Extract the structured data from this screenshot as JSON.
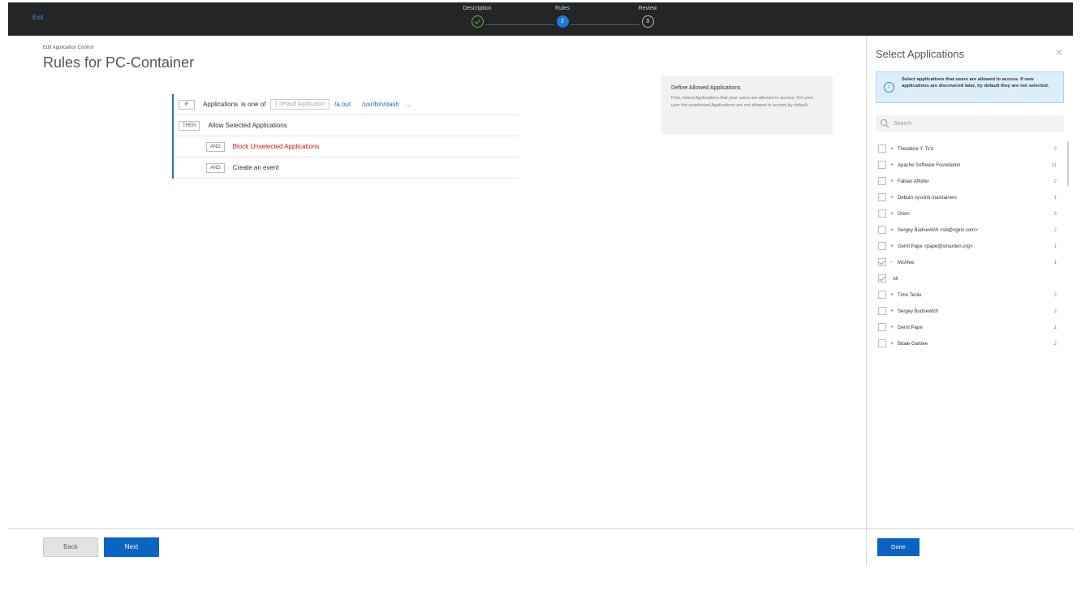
{
  "topbar": {
    "exit_label": "Exit",
    "steps": [
      {
        "label": "Description",
        "marker": "",
        "state": "done"
      },
      {
        "label": "Rules",
        "marker": "2",
        "state": "active"
      },
      {
        "label": "Review",
        "marker": "3",
        "state": "todo"
      }
    ]
  },
  "main": {
    "breadcrumb": "Edit Application Control",
    "title": "Rules for PC-Container",
    "rules": {
      "if_tag": "IF",
      "if_subject": "Applications",
      "if_operator": "is one of",
      "if_default_box": "1 default Application",
      "if_apps": [
        "/a.out",
        "/usr/bin/dash"
      ],
      "if_more": "...",
      "then_tag": "THEN",
      "then_text": "Allow Selected Applications",
      "and1_tag": "AND",
      "and1_text": "Block Unselected Applications",
      "and2_tag": "AND",
      "and2_text": "Create an event"
    },
    "info": {
      "title": "Define Allowed Applications",
      "body": "First, select Applications that your users are allowed to access. For your user the unselected Applications are not allowed to access by default."
    },
    "back_label": "Back",
    "next_label": "Next"
  },
  "panel": {
    "title": "Select Applications",
    "close_glyph": "✕",
    "notice": "Select applications that users are allowed to access. If new applications are discovered later, by default they are not selected.",
    "search_placeholder": "Search",
    "items": [
      {
        "expander": "+",
        "name": "Theodore Y. Ts'o",
        "count": "3",
        "checked": false
      },
      {
        "expander": "+",
        "name": "Apache Software Foundation",
        "count": "11",
        "checked": false
      },
      {
        "expander": "+",
        "name": "Fabian Affolter",
        "count": "2",
        "checked": false
      },
      {
        "expander": "+",
        "name": "Debian sysvinit maintainers",
        "count": "1",
        "checked": false
      },
      {
        "expander": "+",
        "name": "Orion",
        "count": "3",
        "checked": false
      },
      {
        "expander": "+",
        "name": "Sergey Budnevitch <sb@nginx.com>",
        "count": "2",
        "checked": false
      },
      {
        "expander": "+",
        "name": "Gerrit Pape <pape@smarden.org>",
        "count": "1",
        "checked": false
      },
      {
        "expander": "-",
        "name": "McAfee",
        "count": "1",
        "checked": true
      },
      {
        "expander": "",
        "name": "All",
        "count": "",
        "checked": true,
        "sub": true
      },
      {
        "expander": "+",
        "name": "Timo Teräs",
        "count": "2",
        "checked": false
      },
      {
        "expander": "+",
        "name": "Sergey Budnevitch",
        "count": "2",
        "checked": false
      },
      {
        "expander": "+",
        "name": "Gerrit Pape",
        "count": "1",
        "checked": false
      },
      {
        "expander": "+",
        "name": "Bdale Garbee",
        "count": "2",
        "checked": false
      }
    ],
    "done_label": "Done"
  },
  "colors": {
    "topbar_bg": "#242526",
    "accent_blue": "#0a64c2",
    "step_done_green": "#5fb04a",
    "danger_red": "#d0141c",
    "notice_bg": "#dceefa"
  }
}
